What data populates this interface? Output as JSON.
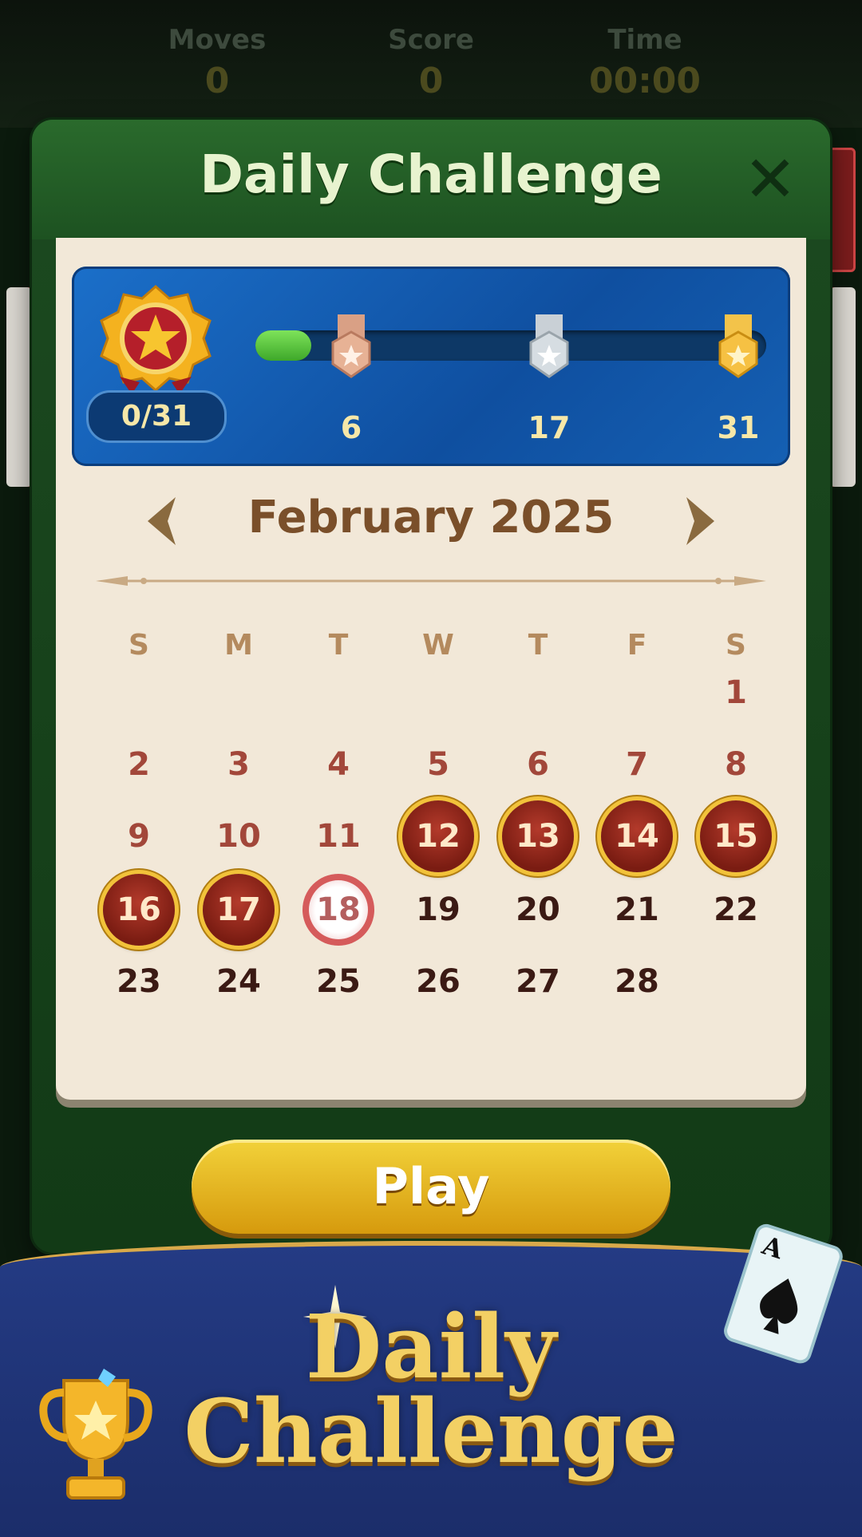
{
  "stats": [
    {
      "label": "Moves",
      "value": "0"
    },
    {
      "label": "Score",
      "value": "0"
    },
    {
      "label": "Time",
      "value": "00:00"
    }
  ],
  "dialog": {
    "title": "Daily Challenge",
    "close_icon": "close-icon"
  },
  "progress": {
    "completed_label": "0/31",
    "fill_fraction": 0.11,
    "milestones": [
      {
        "value": "6",
        "medal": "bronze-medal-icon"
      },
      {
        "value": "17",
        "medal": "silver-medal-icon"
      },
      {
        "value": "31",
        "medal": "gold-medal-icon"
      }
    ]
  },
  "calendar": {
    "month_title": "February 2025",
    "weekdays": [
      "S",
      "M",
      "T",
      "W",
      "T",
      "F",
      "S"
    ],
    "rows": [
      [
        "",
        "",
        "",
        "",
        "",
        "",
        "1"
      ],
      [
        "2",
        "3",
        "4",
        "5",
        "6",
        "7",
        "8"
      ],
      [
        "9",
        "10",
        "11",
        "12",
        "13",
        "14",
        "15"
      ],
      [
        "16",
        "17",
        "18",
        "19",
        "20",
        "21",
        "22"
      ],
      [
        "23",
        "24",
        "25",
        "26",
        "27",
        "28",
        ""
      ]
    ],
    "completed_days": [
      "12",
      "13",
      "14",
      "15",
      "16",
      "17"
    ],
    "today": "18",
    "past_days_end": "18"
  },
  "play_button": {
    "label": "Play"
  },
  "banner": {
    "line1": "Daily",
    "line2": "Challenge"
  },
  "colors": {
    "accent_gold": "#f2c23a",
    "header_green": "#2a6a2c",
    "panel_cream": "#f2e8d8",
    "completed_red": "#7a1c12",
    "banner_blue": "#243b84"
  }
}
